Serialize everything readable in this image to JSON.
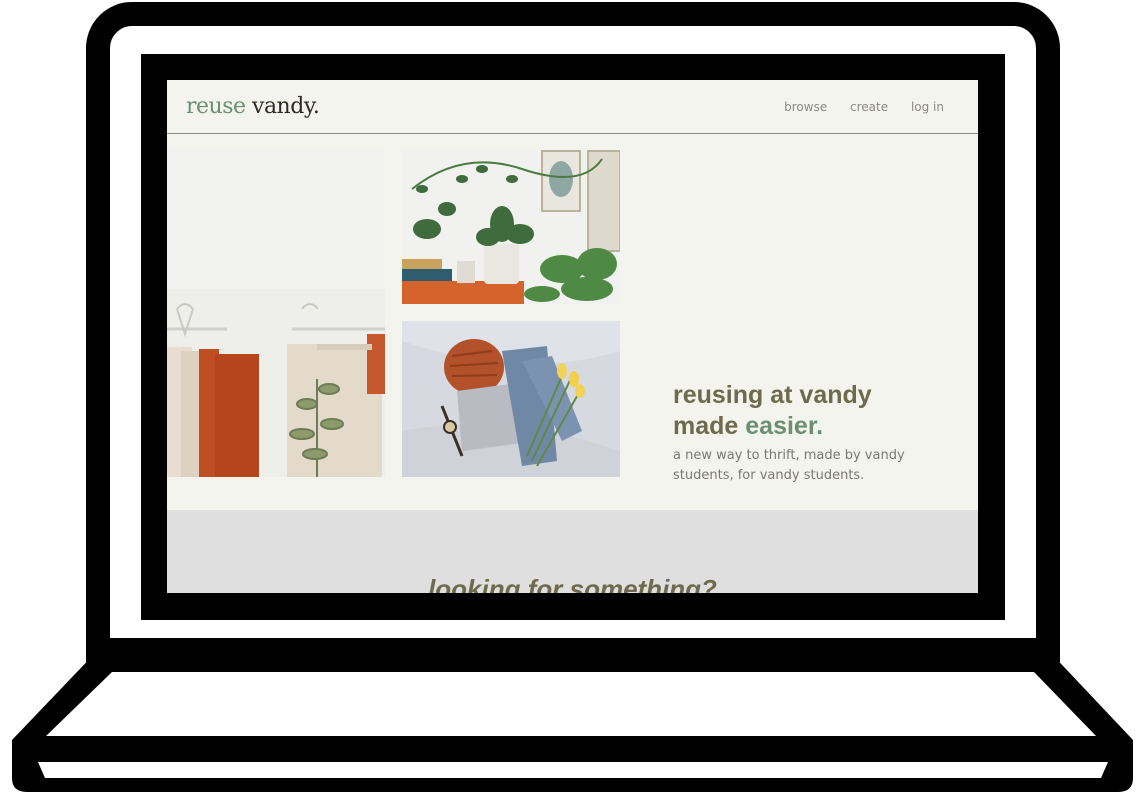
{
  "site": {
    "logo": {
      "part1": "reuse",
      "part2": "vandy."
    },
    "nav": {
      "browse": "browse",
      "create": "create",
      "login": "log in"
    }
  },
  "hero": {
    "title_line1": "reusing at vandy",
    "title_line2_plain": "made ",
    "title_line2_accent": "easier.",
    "subtitle": "a new way to thrift, made by vandy students, for vandy students."
  },
  "search_section": {
    "heading": "looking for something?"
  },
  "colors": {
    "brand_green": "#6b8f70",
    "heading_olive": "#6e6a4c",
    "page_bg": "#f4f4ef",
    "section_grey": "#e0dfdf"
  }
}
